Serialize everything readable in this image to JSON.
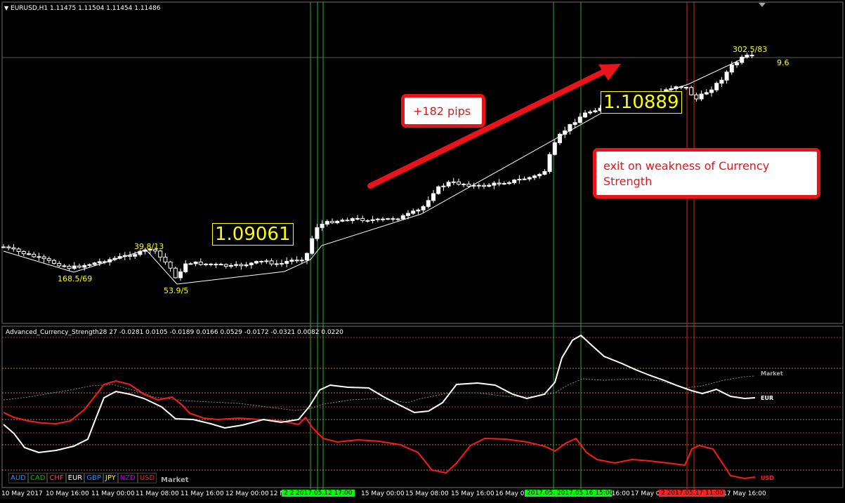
{
  "chart": {
    "symbol_header": "EURUSD,H1  1.11475 1.11504 1.11454 1.11486",
    "callouts": {
      "pips": "+182 pips",
      "exit": "exit on weakness of Currency Strength"
    },
    "entry_price_label": "1.09061",
    "exit_price_label": "1.10889",
    "swing_labels": {
      "low_a": "168.5/69",
      "high_a": "39.8/13",
      "low_b": "53.9/5",
      "high_top": "302.5/83",
      "right_val": "9.6"
    }
  },
  "indicator": {
    "header": "Advanced_Currency_Strength28 27 -0.0281 0.0105 -0.0189 0.0166 0.0529 -0.0172 -0.0321 0.0082 0.0220",
    "line_labels": {
      "market": "Market",
      "eur": "EUR",
      "usd": "USD"
    },
    "currency_buttons": [
      {
        "code": "AUD",
        "color": "#1e90ff"
      },
      {
        "code": "CAD",
        "color": "#00c000"
      },
      {
        "code": "CHF",
        "color": "#ff4040"
      },
      {
        "code": "EUR",
        "color": "#ffffff"
      },
      {
        "code": "GBP",
        "color": "#1e90ff"
      },
      {
        "code": "JPY",
        "color": "#ffff00"
      },
      {
        "code": "NZD",
        "color": "#c000ff"
      },
      {
        "code": "USD",
        "color": "#ff2020"
      }
    ],
    "market_button": "Market"
  },
  "time_axis": {
    "labels": [
      "10 May 2017",
      "10 May 16:00",
      "11 May 00:00",
      "11 May 08:00",
      "11 May 16:00",
      "12 May 00:00",
      "12 May 0",
      "15 May 00:00",
      "15 May 08:00",
      "15 May 16:00",
      "16 May 0",
      "16 May 16:00",
      "17 May 0",
      "17 May 16:00"
    ],
    "highlights": [
      {
        "text": "2 2 2017.05.12 17:00",
        "color": "#00ff00"
      },
      {
        "text": "2017.05.  2017.05.16 15:00",
        "color": "#00ff00"
      },
      {
        "text": "2 2017.05.17 11:00",
        "color": "#ff2020"
      }
    ]
  },
  "colors": {
    "background": "#000000",
    "bull_candle": "#ffffff",
    "bear_candle": "#000000",
    "green_vline": "#2ea82e",
    "red_vline": "#e02020",
    "price_label": "#ffff00",
    "callout_border": "#e8141a",
    "eur_line": "#ffffff",
    "usd_line": "#ff1a1a"
  }
}
